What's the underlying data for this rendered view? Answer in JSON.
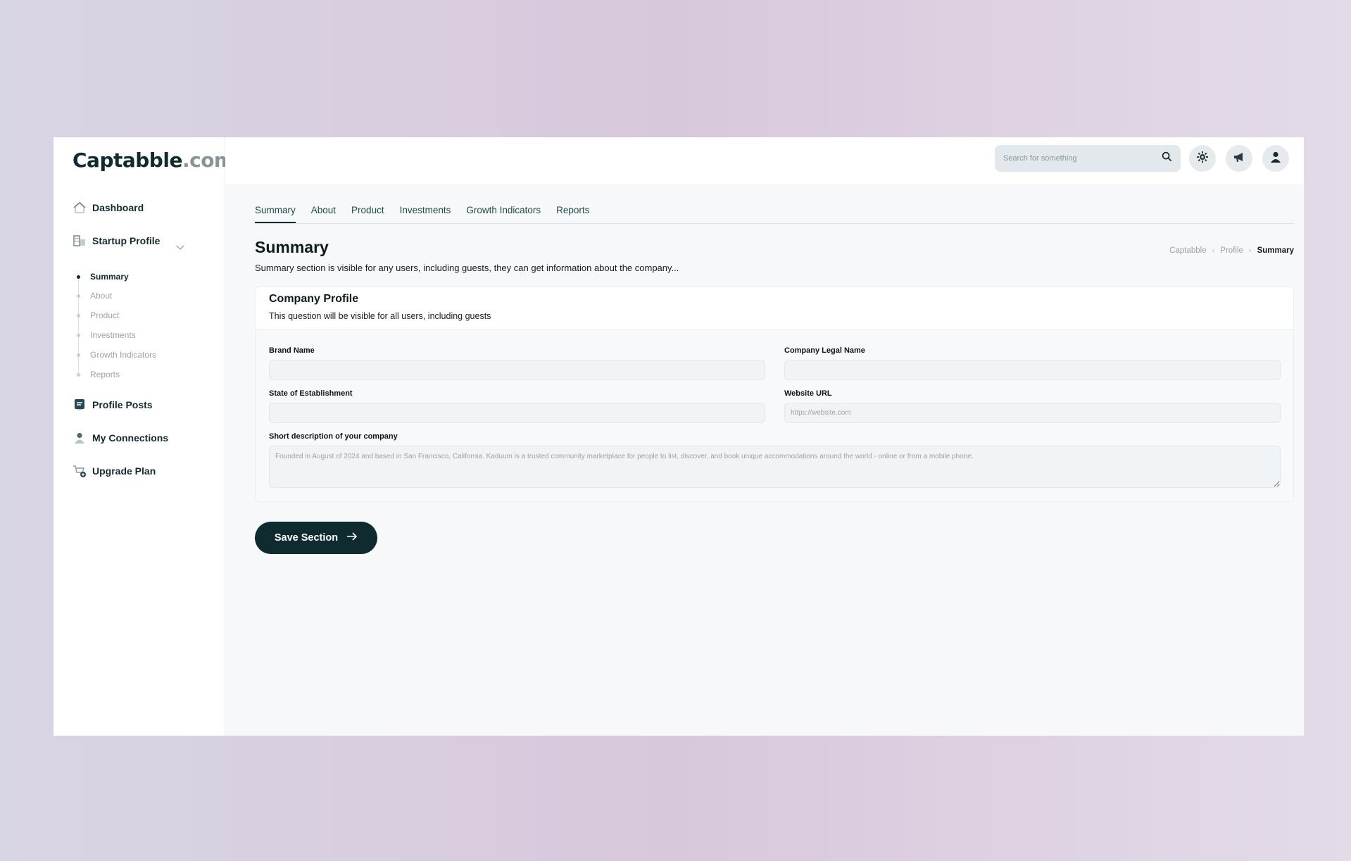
{
  "brand": {
    "name": "Captabble",
    "domain": ".com"
  },
  "sidebar": {
    "items": [
      {
        "label": "Dashboard",
        "icon": "home-icon"
      },
      {
        "label": "Startup Profile",
        "icon": "building-icon"
      },
      {
        "label": "Profile Posts",
        "icon": "posts-icon"
      },
      {
        "label": "My Connections",
        "icon": "user-icon"
      },
      {
        "label": "Upgrade Plan",
        "icon": "cart-icon"
      }
    ],
    "subitems": [
      "Summary",
      "About",
      "Product",
      "Investments",
      "Growth Indicators",
      "Reports"
    ],
    "active_subitem": "Summary"
  },
  "topbar": {
    "search_placeholder": "Search for something",
    "icons": [
      "search-icon",
      "settings-icon",
      "megaphone-icon",
      "profile-icon"
    ]
  },
  "tabs": [
    "Summary",
    "About",
    "Product",
    "Investments",
    "Growth Indicators",
    "Reports"
  ],
  "active_tab": "Summary",
  "page": {
    "title": "Summary",
    "description": "Summary section is visible for any users, including guests, they can get information about the company..."
  },
  "breadcrumb": [
    "Captabble",
    "Profile",
    "Summary"
  ],
  "card": {
    "title": "Company Profile",
    "subtitle": "This question will be visible for all users, including guests",
    "fields": {
      "brand_name": {
        "label": "Brand Name",
        "value": "",
        "placeholder": ""
      },
      "legal_name": {
        "label": "Company Legal Name",
        "value": "",
        "placeholder": ""
      },
      "state": {
        "label": "State of Establishment",
        "value": "",
        "placeholder": ""
      },
      "website": {
        "label": "Website URL",
        "value": "",
        "placeholder": "https://website.com"
      },
      "description": {
        "label": "Short description of your company",
        "value": "",
        "placeholder": "Founded in August of 2024 and based in San Francisco, California. Kaduum is a trusted community marketplace for people to list, discover, and book unique accommodations around the world - online or from a mobile phone."
      }
    }
  },
  "save_button": {
    "label": "Save Section"
  },
  "colors": {
    "primary": "#0f2b30",
    "tab_text": "#1d4a4f",
    "muted": "#9aa3a6"
  }
}
